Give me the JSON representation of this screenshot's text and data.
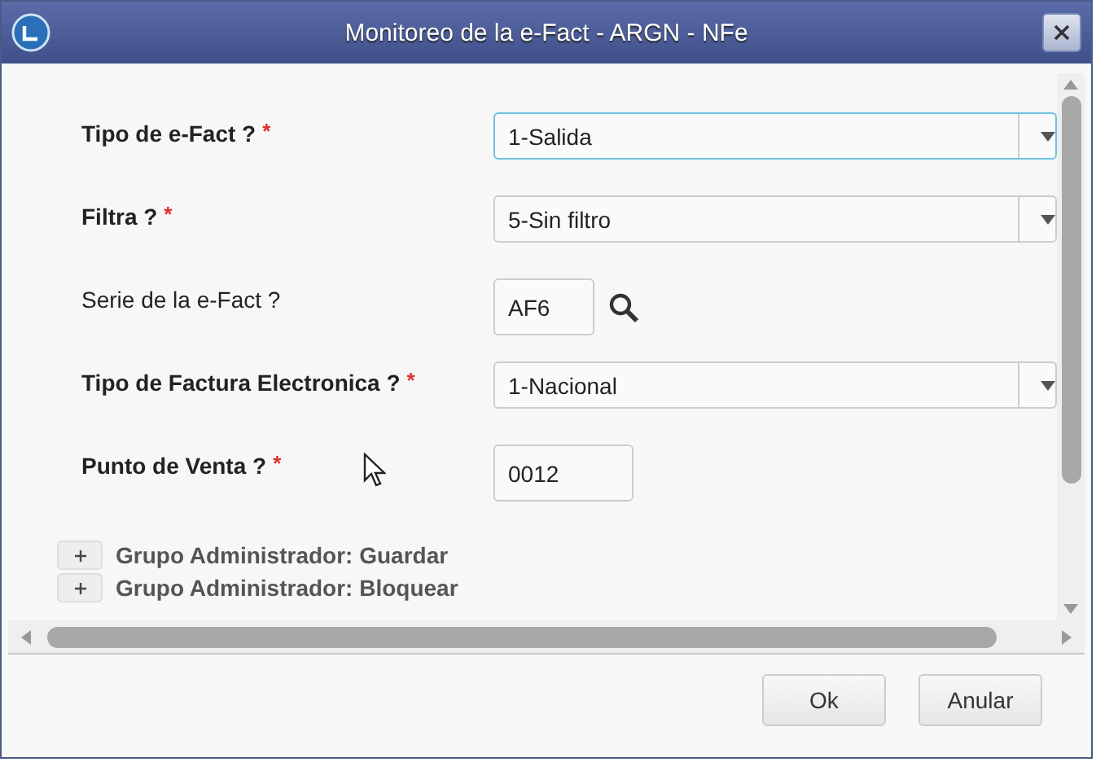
{
  "window": {
    "title": "Monitoreo de la e-Fact - ARGN - NFe"
  },
  "fields": [
    {
      "label": "Tipo de e-Fact ?",
      "bold": true,
      "required_mark": "*",
      "kind": "select",
      "value": "1-Salida",
      "focused": true
    },
    {
      "label": "Filtra ?",
      "bold": true,
      "required_mark": "*",
      "kind": "select",
      "value": "5-Sin filtro",
      "focused": false
    },
    {
      "label": "Serie de la e-Fact ?",
      "bold": false,
      "kind": "lookup",
      "value": "AF6"
    },
    {
      "label": "Tipo de Factura Electronica ?",
      "bold": true,
      "required_mark": "*",
      "kind": "select",
      "value": "1-Nacional",
      "focused": false
    },
    {
      "label": "Punto de Venta ?",
      "bold": true,
      "required_mark": "*",
      "kind": "text",
      "value": "0012"
    }
  ],
  "groups": [
    {
      "label": "Grupo Administrador: Guardar"
    },
    {
      "label": "Grupo Administrador: Bloquear"
    }
  ],
  "buttons": [
    "Ok",
    "Anular"
  ]
}
